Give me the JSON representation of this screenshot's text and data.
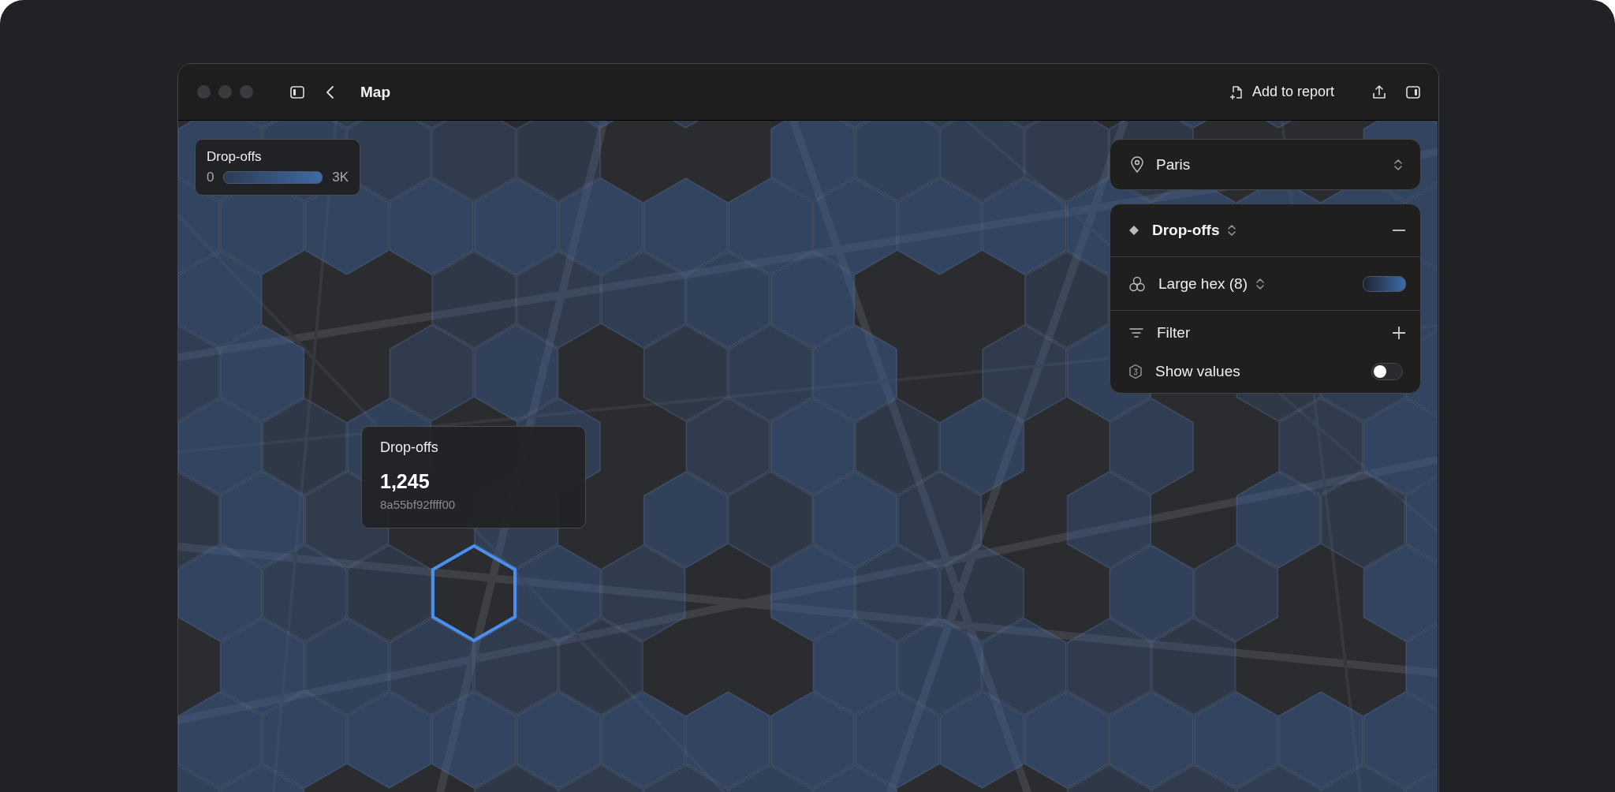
{
  "window": {
    "title": "Map",
    "actions": [
      {
        "label": "Add to report"
      }
    ]
  },
  "legend": {
    "title": "Drop-offs",
    "min": "0",
    "max": "3K"
  },
  "location": {
    "value": "Paris"
  },
  "layer": {
    "title": "Drop-offs",
    "resolution": "Large hex (8)",
    "filter_label": "Filter",
    "show_values": {
      "label": "Show values",
      "on": false
    }
  },
  "tooltip": {
    "title": "Drop-offs",
    "value": "1,245",
    "cell_id": "8a55bf92ffff00"
  }
}
